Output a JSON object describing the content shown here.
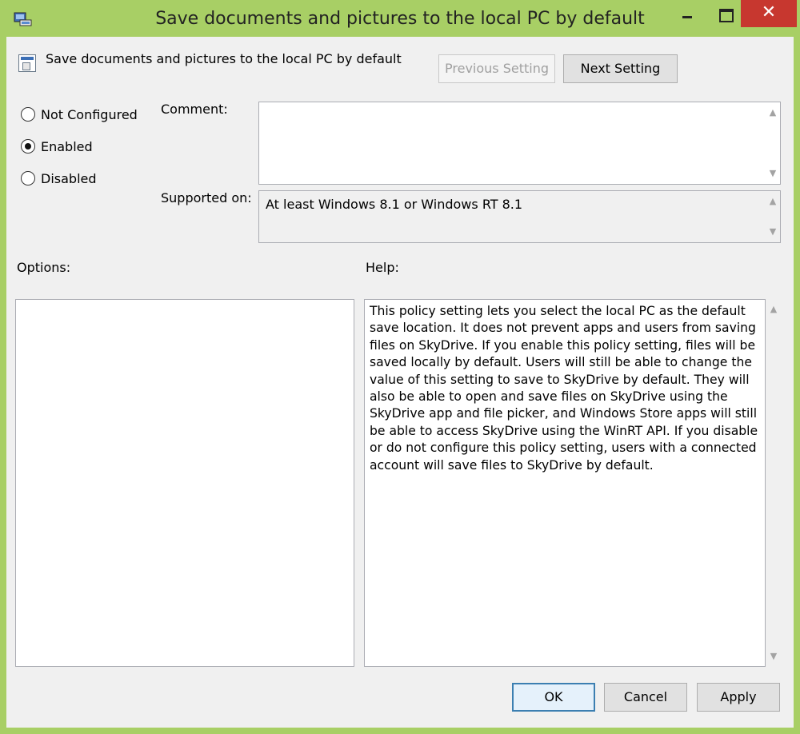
{
  "window": {
    "title": "Save documents and pictures to the local PC by default",
    "close_glyph": "✕"
  },
  "header": {
    "setting_name": "Save documents and pictures to the local PC by default",
    "prev_label": "Previous Setting",
    "next_label": "Next Setting"
  },
  "state": {
    "options": [
      {
        "label": "Not Configured",
        "selected": false
      },
      {
        "label": "Enabled",
        "selected": true
      },
      {
        "label": "Disabled",
        "selected": false
      }
    ]
  },
  "comment": {
    "label": "Comment:",
    "value": ""
  },
  "supported": {
    "label": "Supported on:",
    "value": "At least Windows 8.1 or Windows RT 8.1"
  },
  "options_panel": {
    "label": "Options:"
  },
  "help_panel": {
    "label": "Help:",
    "text": "This policy setting lets you select the local PC as the default save location. It does not prevent apps and users from saving files on SkyDrive. If you enable this policy setting, files will be saved locally by default. Users will still be able to change the value of this setting to save to SkyDrive by default. They will also be able to open and save files on SkyDrive using the SkyDrive app and file picker, and Windows Store apps will still be able to access SkyDrive using the WinRT API. If you disable or do not configure this policy setting, users with a connected account will save files to SkyDrive by default."
  },
  "footer": {
    "ok_label": "OK",
    "cancel_label": "Cancel",
    "apply_label": "Apply"
  },
  "icons": {
    "up": "▲",
    "down": "▼"
  },
  "colors": {
    "titlebar": "#a8cf65",
    "close": "#c7372f",
    "focus": "#3c7fb1"
  }
}
